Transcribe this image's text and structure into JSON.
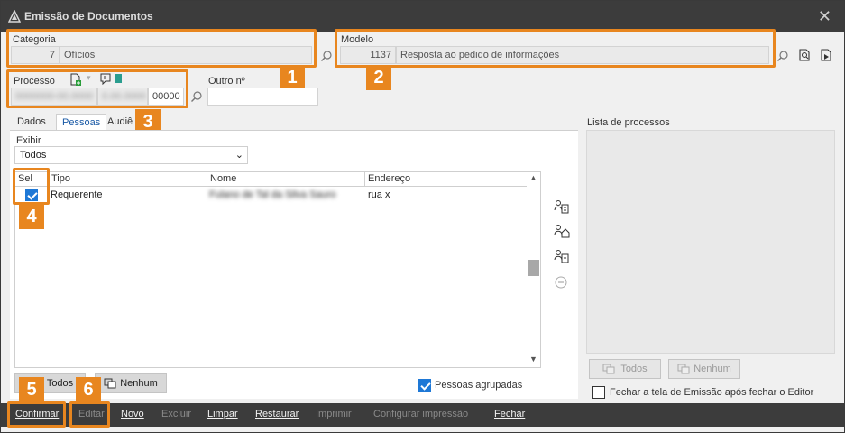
{
  "window": {
    "title": "Emissão de Documentos"
  },
  "categoria": {
    "label": "Categoria",
    "code": "7",
    "name": "Ofícios"
  },
  "modelo": {
    "label": "Modelo",
    "code": "1137",
    "name": "Resposta ao pedido de informações"
  },
  "processo": {
    "label": "Processo",
    "part1": "0000000-00.0000",
    "part2": "0.00.0000",
    "part3": "00000"
  },
  "outro": {
    "label": "Outro nº",
    "value": ""
  },
  "tabs": [
    {
      "label": "Dados"
    },
    {
      "label": "Pessoas"
    },
    {
      "label": "Audiê"
    }
  ],
  "exibir": {
    "label": "Exibir",
    "value": "Todos"
  },
  "grid": {
    "headers": {
      "sel": "Sel",
      "tipo": "Tipo",
      "nome": "Nome",
      "endereco": "Endereço"
    },
    "rows": [
      {
        "selected": true,
        "tipo": "Requerente",
        "nome": "Fulano de Tal da Silva Sauro",
        "endereco": "rua x"
      }
    ]
  },
  "buttons": {
    "todos": "Todos",
    "nenhum": "Nenhum"
  },
  "pessoas_agrupadas": {
    "label": "Pessoas agrupadas",
    "checked": true
  },
  "lista_processos": {
    "label": "Lista de processos",
    "todos": "Todos",
    "nenhum": "Nenhum"
  },
  "fechar_tela": {
    "label": "Fechar a tela de Emissão após fechar o Editor",
    "checked": false
  },
  "footer": {
    "confirmar": "Confirmar",
    "editar": "Editar",
    "novo": "Novo",
    "excluir": "Excluir",
    "limpar": "Limpar",
    "restaurar": "Restaurar",
    "imprimir": "Imprimir",
    "configurar": "Configurar impressão",
    "fechar": "Fechar"
  },
  "badges": [
    "1",
    "2",
    "3",
    "4",
    "5",
    "6"
  ],
  "colors": {
    "accent": "#e8861f",
    "titlebar": "#3c3c3c",
    "check": "#1e78d6",
    "link": "#1a5aa6"
  }
}
